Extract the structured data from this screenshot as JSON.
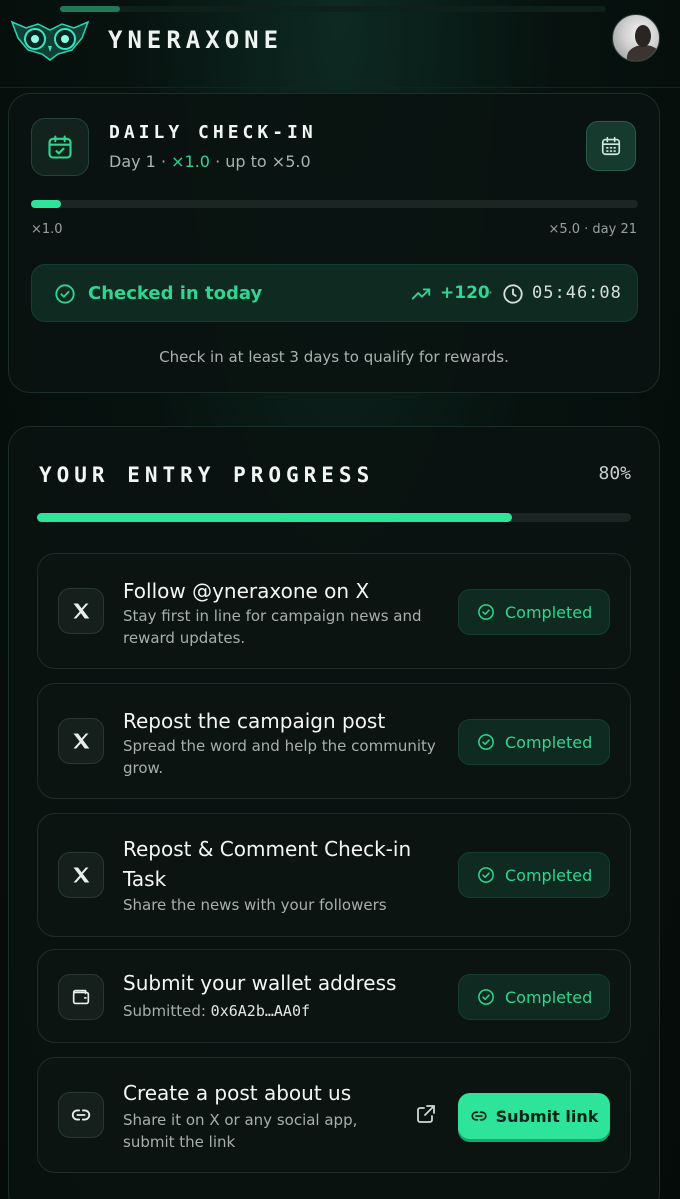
{
  "header": {
    "brand": "YNERAXONE",
    "scroll_progress": 0.11,
    "logo_icon": "owl-logo-icon",
    "avatar_icon": "user-avatar"
  },
  "checkin": {
    "title": "DAILY CHECK-IN",
    "day_label": "Day 1",
    "sep1": " · ",
    "multiplier": "×1.0",
    "sep2": " · ",
    "upto": "up to ×5.0",
    "progress_fraction": 0.05,
    "min_label": "×1.0",
    "max_label": "×5.0 · day 21",
    "status": "Checked in today",
    "points": "+120",
    "separator": "·",
    "timer": "05:46:08",
    "note": "Check in at least 3 days to qualify for rewards.",
    "icon": "calendar-check-icon",
    "calendar_button_icon": "calendar-grid-icon"
  },
  "entry": {
    "title": "YOUR ENTRY PROGRESS",
    "percent_label": "80%",
    "progress_fraction": 0.8,
    "tasks": [
      {
        "icon": "x-logo-icon",
        "title": "Follow @yneraxone on X",
        "desc": "Stay first in line for campaign news and reward updates.",
        "status": "Completed"
      },
      {
        "icon": "x-logo-icon",
        "title": "Repost the campaign post",
        "desc": "Spread the word and help the community grow.",
        "status": "Completed"
      },
      {
        "icon": "x-logo-icon",
        "title": "Repost & Comment Check-in Task",
        "desc": "Share the news with your followers",
        "status": "Completed"
      },
      {
        "icon": "wallet-icon",
        "title": "Submit your wallet address",
        "desc_prefix": "Submitted: ",
        "desc_value": "0x6A2b…AA0f",
        "status": "Completed"
      },
      {
        "icon": "link-icon",
        "title": "Create a post about us",
        "desc": "Share it on X or any social app, submit the link",
        "action": "Submit link"
      }
    ]
  },
  "colors": {
    "accent": "#2ee39a",
    "accent_text": "#2fd591",
    "background": "#07120f"
  }
}
